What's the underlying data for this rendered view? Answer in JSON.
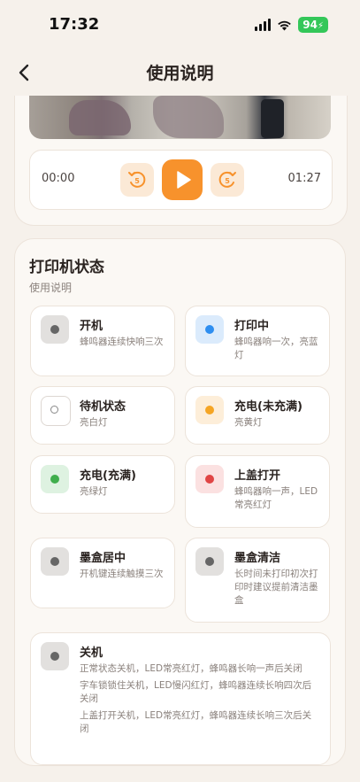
{
  "status_bar": {
    "time": "17:32",
    "battery": "94"
  },
  "nav": {
    "title": "使用说明"
  },
  "player": {
    "current_time": "00:00",
    "duration": "01:27"
  },
  "section": {
    "title": "打印机状态",
    "subtitle": "使用说明",
    "items": [
      {
        "title": "开机",
        "desc": [
          "蜂鸣器连续快响三次"
        ],
        "icon": "gray-dot-icon",
        "box_color": "#e2e0de",
        "dot_color": "#666666"
      },
      {
        "title": "打印中",
        "desc": [
          "蜂鸣器响一次，亮蓝灯"
        ],
        "icon": "blue-dot-icon",
        "box_color": "#dbebfc",
        "dot_color": "#2e8ef0"
      },
      {
        "title": "待机状态",
        "desc": [
          "亮白灯"
        ],
        "icon": "white-dot-icon",
        "box_color": "#ffffff",
        "dot_color": "#ffffff"
      },
      {
        "title": "充电(未充满)",
        "desc": [
          "亮黄灯"
        ],
        "icon": "yellow-dot-icon",
        "box_color": "#fdeed9",
        "dot_color": "#f5a524"
      },
      {
        "title": "充电(充满)",
        "desc": [
          "亮绿灯"
        ],
        "icon": "green-dot-icon",
        "box_color": "#def2e1",
        "dot_color": "#3fae4c"
      },
      {
        "title": "上盖打开",
        "desc": [
          "蜂鸣器响一声，LED常亮红灯"
        ],
        "icon": "red-dot-icon",
        "box_color": "#fbe1e1",
        "dot_color": "#e04545"
      },
      {
        "title": "墨盒居中",
        "desc": [
          "开机键连续触摸三次"
        ],
        "icon": "gray-dot-icon",
        "box_color": "#e2e0de",
        "dot_color": "#666666"
      },
      {
        "title": "墨盒清洁",
        "desc": [
          "长时间未打印初次打印时建议提前清洁墨盒"
        ],
        "icon": "gray-dot-icon",
        "box_color": "#e2e0de",
        "dot_color": "#666666"
      },
      {
        "title": "关机",
        "desc": [
          "正常状态关机，LED常亮红灯，蜂鸣器长响一声后关闭",
          "字车锁锁住关机，LED慢闪红灯，蜂鸣器连续长响四次后关闭",
          "上盖打开关机，LED常亮红灯，蜂鸣器连续长响三次后关闭"
        ],
        "icon": "gray-dot-icon",
        "box_color": "#e2e0de",
        "dot_color": "#666666"
      }
    ]
  },
  "colors": {
    "accent": "#f7922c",
    "accent_soft": "#fbe9d6",
    "background": "#f6f1eb"
  }
}
